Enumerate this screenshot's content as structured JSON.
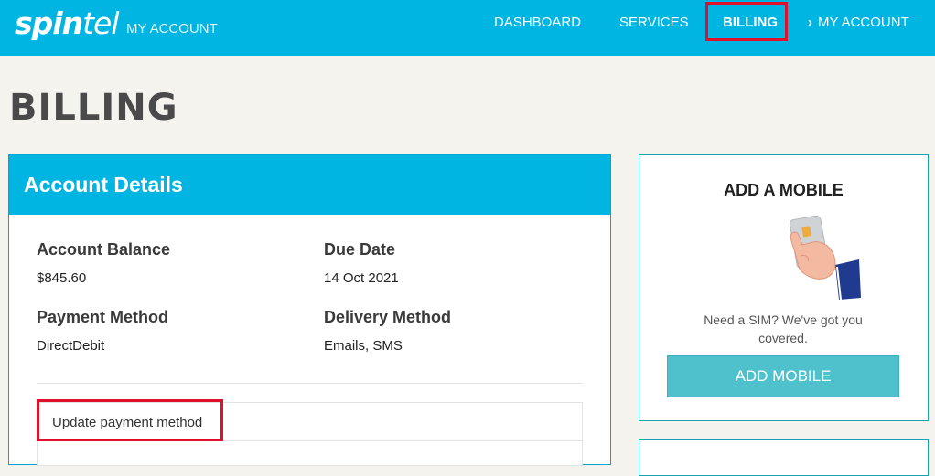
{
  "brand": {
    "logo_bold": "spin",
    "logo_thin": "tel",
    "subtitle": "MY ACCOUNT"
  },
  "nav": {
    "dashboard": "DASHBOARD",
    "services": "SERVICES",
    "billing": "BILLING",
    "my_account": "MY ACCOUNT",
    "active": "BILLING"
  },
  "page": {
    "title": "BILLING"
  },
  "account_details": {
    "header": "Account Details",
    "balance_label": "Account Balance",
    "balance_value": "$845.60",
    "due_label": "Due Date",
    "due_value": "14 Oct 2021",
    "payment_label": "Payment Method",
    "payment_value": "DirectDebit",
    "delivery_label": "Delivery Method",
    "delivery_value": "Emails, SMS",
    "update_link": "Update payment method"
  },
  "add_mobile": {
    "title": "ADD A MOBILE",
    "description": "Need a SIM? We've got you covered.",
    "button": "ADD MOBILE",
    "illustration": "hand-holding-sim-card"
  },
  "colors": {
    "header": "#00b5e2",
    "highlight": "#e0112b",
    "button": "#4fc1cc",
    "background": "#f5f3ee"
  }
}
